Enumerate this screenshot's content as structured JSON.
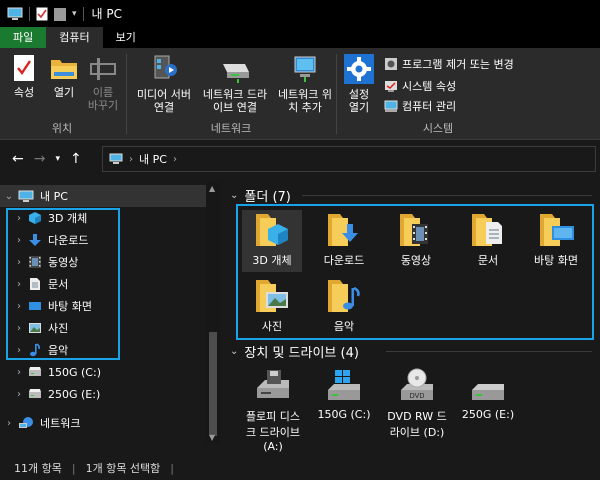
{
  "title": "내 PC",
  "tabs": [
    "파일",
    "컴퓨터",
    "보기"
  ],
  "ribbon": {
    "location": {
      "label": "위치",
      "buttons": [
        {
          "label": "속성",
          "icon": "properties-icon"
        },
        {
          "label": "열기",
          "icon": "open-folder-icon"
        },
        {
          "label": "이름 바꾸기",
          "icon": "rename-icon"
        }
      ]
    },
    "network": {
      "label": "네트워크",
      "buttons": [
        {
          "label": "미디어 서버 연결",
          "icon": "media-server-icon"
        },
        {
          "label": "네트워크 드라이브 연결",
          "icon": "network-drive-icon"
        },
        {
          "label": "네트워크 위치 추가",
          "icon": "network-location-icon"
        }
      ]
    },
    "system": {
      "label": "시스템",
      "open_settings": "설정 열기",
      "items": [
        "프로그램 제거 또는 변경",
        "시스템 속성",
        "컴퓨터 관리"
      ]
    }
  },
  "address": {
    "path": "내 PC"
  },
  "nav": {
    "root": "내 PC",
    "items": [
      "3D 개체",
      "다운로드",
      "동영상",
      "문서",
      "바탕 화면",
      "사진",
      "음악"
    ],
    "drives": [
      "150G (C:)",
      "250G (E:)"
    ],
    "network": "네트워크"
  },
  "content": {
    "folders_header": "폴더 (7)",
    "folders": [
      "3D 개체",
      "다운로드",
      "동영상",
      "문서",
      "바탕 화면",
      "사진",
      "음악"
    ],
    "devices_header": "장치 및 드라이브 (4)",
    "devices": [
      "플로피 디스크 드라이브 (A:)",
      "150G (C:)",
      "DVD RW 드라이브 (D:)",
      "250G (E:)"
    ],
    "dvd_badge": "DVD"
  },
  "status": {
    "count": "11개 항목",
    "selected": "1개 항목 선택함"
  },
  "colors": {
    "accent": "#1aa3e6",
    "file_tab": "#1a7a2f",
    "folder": "#f3c64f",
    "background": "#191919"
  }
}
